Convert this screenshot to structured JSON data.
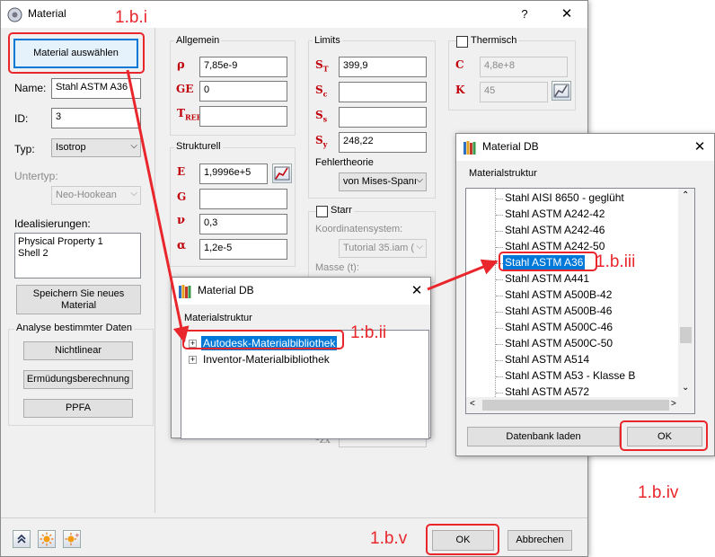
{
  "main_dialog": {
    "title": "Material",
    "help": "?",
    "close": "✕",
    "select_button": "Material auswählen",
    "name_label": "Name:",
    "name_value": "Stahl ASTM A36",
    "id_label": "ID:",
    "id_value": "3",
    "typ_label": "Typ:",
    "typ_value": "Isotrop",
    "untertyp_label": "Untertyp:",
    "untertyp_value": "Neo-Hookean",
    "ideal_label": "Idealisierungen:",
    "ideal_items": [
      "Physical Property 1",
      "Shell 2"
    ],
    "save_button": "Speichern Sie neues Material",
    "analysis_title": "Analyse bestimmter Daten",
    "btn_nonlinear": "Nichtlinear",
    "btn_fatigue": "Ermüdungsberechnung",
    "btn_ppfa": "PPFA",
    "allgemein_title": "Allgemein",
    "rho_value": "7,85e-9",
    "ge_value": "0",
    "tref_value": "",
    "strukturell_title": "Strukturell",
    "e_value": "1,9996e+5",
    "g_value": "",
    "nu_value": "0,3",
    "alpha_value": "1,2e-5",
    "limits_title": "Limits",
    "st_value": "399,9",
    "sc_value": "",
    "ss_value": "",
    "sy_value": "248,22",
    "fehler_label": "Fehlertheorie",
    "fehler_value": "von Mises-Spanı",
    "thermisch_label": "Thermisch",
    "c_value": "4,8e+8",
    "k_value": "45",
    "starr_label": "Starr",
    "koord_label": "Koordinatensystem:",
    "koord_value": "Tutorial 35.iam (",
    "masse_label": "Masse (t):",
    "ok_button": "OK",
    "cancel_button": "Abbrechen"
  },
  "db_dialog_1": {
    "title": "Material DB",
    "close": "✕",
    "struct_label": "Materialstruktur",
    "items": [
      "Autodesk-Materialbibliothek",
      "Inventor-Materialbibliothek"
    ]
  },
  "db_dialog_2": {
    "title": "Material DB",
    "close": "✕",
    "struct_label": "Materialstruktur",
    "items": [
      "Stahl AISI 8650 - geglüht",
      "Stahl ASTM A242-42",
      "Stahl ASTM A242-46",
      "Stahl ASTM A242-50",
      "Stahl ASTM A36",
      "Stahl ASTM A441",
      "Stahl ASTM A500B-42",
      "Stahl ASTM A500B-46",
      "Stahl ASTM A500C-46",
      "Stahl ASTM A500C-50",
      "Stahl ASTM A514",
      "Stahl ASTM A53 - Klasse B",
      "Stahl ASTM A572"
    ],
    "load_button": "Datenbank laden",
    "ok_button": "OK"
  },
  "annotations": {
    "a1": "1.b.i",
    "a2": "1:b.ii",
    "a3": "1.b.iii",
    "a4": "1.b.iv",
    "a5": "1.b.v"
  },
  "colors": {
    "accent": "#0078d7",
    "annotation": "#e8262b",
    "symbol": "#c0000a"
  }
}
